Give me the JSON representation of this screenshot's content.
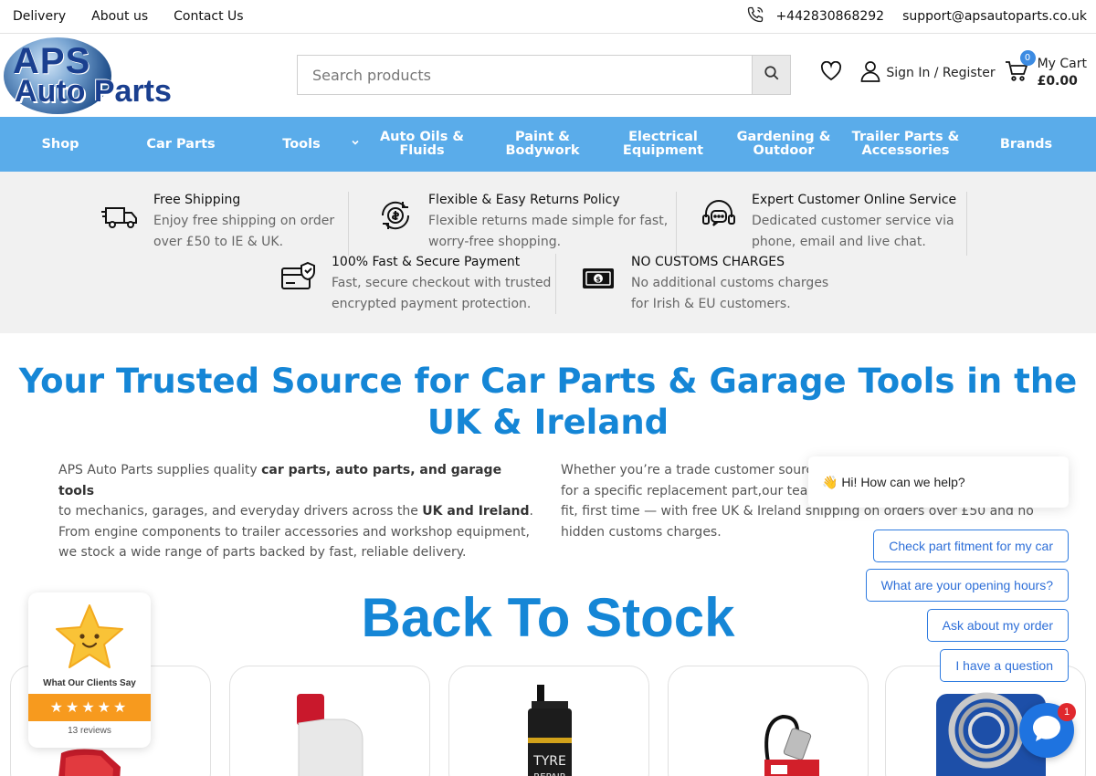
{
  "topbar": {
    "links": [
      "Delivery",
      "About us",
      "Contact Us"
    ],
    "phone": "+442830868292",
    "email": "support@apsautoparts.co.uk"
  },
  "logo": {
    "line1": "APS",
    "line2": "Auto Parts"
  },
  "search": {
    "placeholder": "Search products"
  },
  "header": {
    "account_label": "Sign In / Register",
    "cart_label": "My Cart",
    "cart_total": "£0.00",
    "cart_count": "0"
  },
  "nav": {
    "items": [
      {
        "l1": "Shop",
        "l2": ""
      },
      {
        "l1": "Car Parts",
        "l2": ""
      },
      {
        "l1": "Tools",
        "l2": ""
      },
      {
        "l1": "Auto Oils &",
        "l2": "Fluids"
      },
      {
        "l1": "Paint &",
        "l2": "Bodywork"
      },
      {
        "l1": "Electrical",
        "l2": "Equipment"
      },
      {
        "l1": "Gardening &",
        "l2": "Outdoor"
      },
      {
        "l1": "Trailer Parts &",
        "l2": "Accessories"
      },
      {
        "l1": "Brands",
        "l2": ""
      }
    ]
  },
  "features": [
    {
      "title": "Free Shipping",
      "d1": "Enjoy free shipping on order",
      "d2": "over £50 to IE & UK.",
      "icon": "truck-icon"
    },
    {
      "title": "Flexible & Easy Returns Policy",
      "d1": "Flexible returns made simple for fast,",
      "d2": "worry-free shopping.",
      "icon": "returns-icon"
    },
    {
      "title": "Expert Customer Online Service",
      "d1": "Dedicated customer service via",
      "d2": "phone, email and live chat.",
      "icon": "support-icon"
    },
    {
      "title": "100% Fast & Secure Payment",
      "d1": "Fast, secure checkout with trusted",
      "d2": "encrypted payment protection.",
      "icon": "secure-card-icon"
    },
    {
      "title": "NO CUSTOMS CHARGES",
      "d1": "No additional customs charges",
      "d2": "for Irish & EU customers.",
      "icon": "cash-icon"
    }
  ],
  "headline": {
    "line1": "Your Trusted Source for Car Parts & Garage Tools in the",
    "line2": "UK & Ireland"
  },
  "intro_left": {
    "t1": "APS Auto Parts supplies quality ",
    "b1": "car parts, auto parts, and garage tools",
    "t2": "to mechanics, garages, and everyday drivers across the ",
    "b2": "UK and Ireland",
    "t3": ".",
    "l3": "From engine components to trailer accessories and workshop equipment,",
    "l4": "we stock a wide range of parts backed by fast, reliable delivery."
  },
  "intro_right": {
    "l1": "Whether you’re a trade customer sourcir",
    "l2": "for a specific replacement part,our team",
    "l3": "fit, first time — with free UK & Ireland shipping on orders over £50 and no",
    "l4": "hidden customs charges."
  },
  "section_title": "Back To Stock",
  "reviews": {
    "label": "What Our Clients Say",
    "stars": "★★★★★",
    "count": "13 reviews"
  },
  "chat": {
    "greeting": "👋 Hi! How can we help?",
    "quick_replies": [
      "Check part fitment for my car",
      "What are your opening hours?",
      "Ask about my order",
      "I have a question"
    ],
    "unread": "1"
  },
  "colors": {
    "nav": "#5aacea",
    "accent": "#1586d6",
    "review_bar": "#f79a1e",
    "chat": "#1e73e0"
  }
}
